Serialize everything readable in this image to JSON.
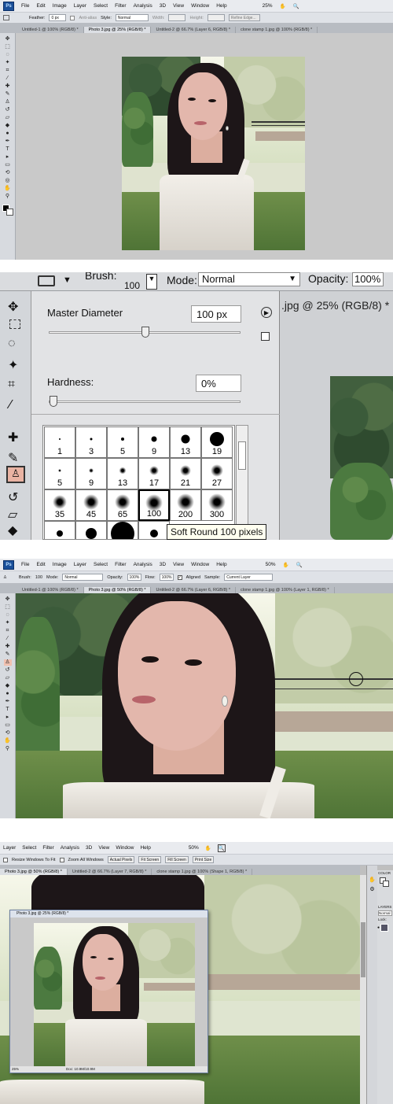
{
  "panel1": {
    "menu": [
      "File",
      "Edit",
      "Image",
      "Layer",
      "Select",
      "Filter",
      "Analysis",
      "3D",
      "View",
      "Window",
      "Help"
    ],
    "zoom": "25%",
    "options": {
      "feather_label": "Feather:",
      "feather_value": "0 px",
      "antialias_label": "Anti-alias",
      "style_label": "Style:",
      "style_value": "Normal",
      "width_label": "Width:",
      "height_label": "Height:",
      "refine_label": "Refine Edge..."
    },
    "tabs": [
      "Untitled-1 @ 100% (RGB/8) *",
      "Photo 3.jpg @ 25% (RGB/8) *",
      "Untitled-2 @ 66.7% (Layer 6, RGB/8) *",
      "clone stamp 1.jpg @ 100% (RGB/8) *"
    ],
    "active_tab": 1
  },
  "panel2": {
    "brush_label": "Brush:",
    "brush_size": "100",
    "mode_label": "Mode:",
    "mode_value": "Normal",
    "opacity_label": "Opacity:",
    "opacity_value": "100%",
    "doc_tab": ".jpg @ 25% (RGB/8) *",
    "master_diameter_label": "Master Diameter",
    "master_diameter_value": "100 px",
    "master_diameter_fraction": 0.5,
    "hardness_label": "Hardness:",
    "hardness_value": "0%",
    "hardness_fraction": 0,
    "brushes": [
      {
        "label": "1",
        "kind": "hard",
        "d": 2
      },
      {
        "label": "3",
        "kind": "hard",
        "d": 3
      },
      {
        "label": "5",
        "kind": "hard",
        "d": 4
      },
      {
        "label": "9",
        "kind": "hard",
        "d": 7
      },
      {
        "label": "13",
        "kind": "hard",
        "d": 11
      },
      {
        "label": "19",
        "kind": "hard",
        "d": 18
      },
      {
        "label": "5",
        "kind": "soft",
        "d": 4
      },
      {
        "label": "9",
        "kind": "soft",
        "d": 6
      },
      {
        "label": "13",
        "kind": "soft",
        "d": 9
      },
      {
        "label": "17",
        "kind": "soft",
        "d": 12
      },
      {
        "label": "21",
        "kind": "soft",
        "d": 14
      },
      {
        "label": "27",
        "kind": "soft",
        "d": 16
      },
      {
        "label": "35",
        "kind": "soft",
        "d": 18
      },
      {
        "label": "45",
        "kind": "soft",
        "d": 20
      },
      {
        "label": "65",
        "kind": "soft",
        "d": 20
      },
      {
        "label": "100",
        "kind": "soft",
        "d": 22,
        "selected": true
      },
      {
        "label": "200",
        "kind": "soft",
        "d": 22
      },
      {
        "label": "300",
        "kind": "soft",
        "d": 22
      }
    ],
    "tooltip": "Soft Round 100 pixels"
  },
  "panel3": {
    "menu": [
      "File",
      "Edit",
      "Image",
      "Layer",
      "Select",
      "Filter",
      "Analysis",
      "3D",
      "View",
      "Window",
      "Help"
    ],
    "zoom": "50%",
    "options": {
      "brush_label": "Brush:",
      "brush_size": "100",
      "mode_label": "Mode:",
      "mode_value": "Normal",
      "opacity_label": "Opacity:",
      "opacity_value": "100%",
      "flow_label": "Flow:",
      "flow_value": "100%",
      "aligned_label": "Aligned",
      "sample_label": "Sample:",
      "sample_value": "Current Layer"
    },
    "tabs": [
      "Untitled-1 @ 100% (RGB/8) *",
      "Photo 3.jpg @ 50% (RGB/8) *",
      "Untitled-2 @ 66.7% (Layer 6, RGB/8) *",
      "clone stamp 1.jpg @ 100% (Layer 1, RGB/8) *"
    ],
    "active_tab": 1
  },
  "panel4": {
    "menu": [
      "Layer",
      "Select",
      "Filter",
      "Analysis",
      "3D",
      "View",
      "Window",
      "Help"
    ],
    "zoom": "50%",
    "options": {
      "resize_label": "Resize Windows To Fit",
      "zoom_all_label": "Zoom All Windows",
      "actual_pixels": "Actual Pixels",
      "fit_screen": "Fit Screen",
      "fill_screen": "Fill Screen",
      "print_size": "Print Size"
    },
    "tabs": [
      "Photo 3.jpg @ 50% (RGB/8) *",
      "Untitled-2 @ 66.7% (Layer 7, RGB/8) *",
      "clone stamp 1.jpg @ 100% (Shape 1, RGB/8) *"
    ],
    "float_title": "Photo 3.jpg @ 25% (RGB/8) *",
    "float_zoom": "25%",
    "float_doc": "Doc: 10.9M/10.9M",
    "right_panels": {
      "color": "COLOR",
      "layers": "LAYERS",
      "blend": "Normal",
      "lock": "Lock:"
    }
  }
}
